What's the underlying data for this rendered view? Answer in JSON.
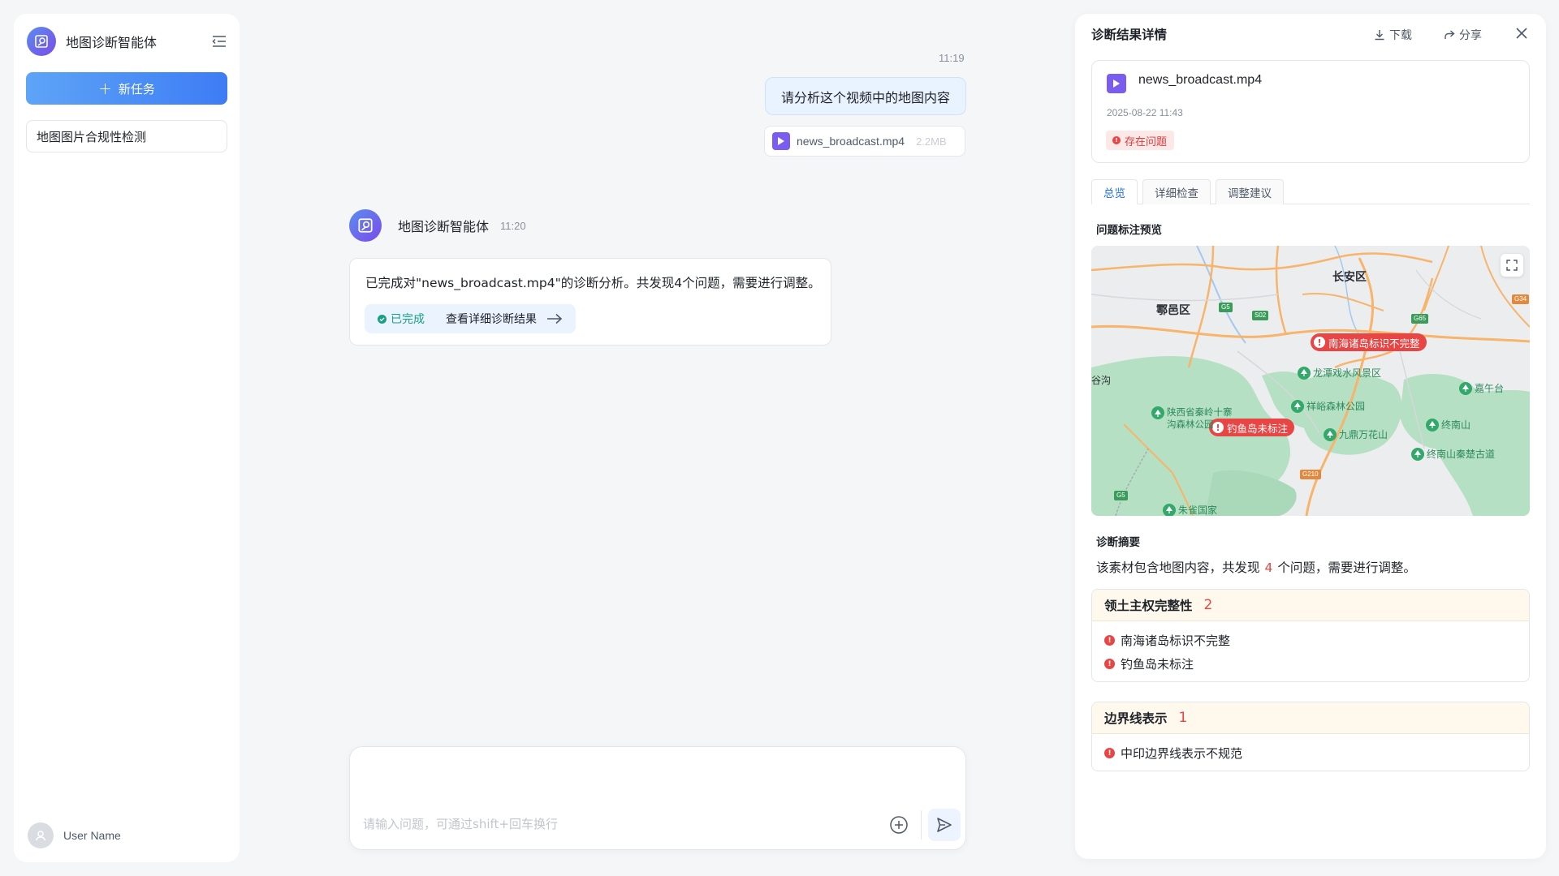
{
  "sidebar": {
    "app_name": "地图诊断智能体",
    "new_task_label": "新任务",
    "history": [
      {
        "label": "地图图片合规性检测"
      }
    ],
    "user_name": "User Name"
  },
  "chat": {
    "user_message": {
      "time": "11:19",
      "text": "请分析这个视频中的地图内容",
      "attachment": {
        "name": "news_broadcast.mp4",
        "size": "2.2MB"
      }
    },
    "bot_message": {
      "name": "地图诊断智能体",
      "time": "11:20",
      "text": "已完成对\"news_broadcast.mp4\"的诊断分析。共发现4个问题，需要进行调整。",
      "status": "已完成",
      "link_label": "查看详细诊断结果"
    },
    "composer": {
      "placeholder": "请输入问题，可通过shift+回车换行"
    }
  },
  "panel": {
    "title": "诊断结果详情",
    "download_label": "下载",
    "share_label": "分享",
    "file": {
      "name": "news_broadcast.mp4",
      "date": "2025-08-22 11:43",
      "status": "存在问题"
    },
    "tabs": [
      {
        "label": "总览",
        "active": true
      },
      {
        "label": "详细检查",
        "active": false
      },
      {
        "label": "调整建议",
        "active": false
      }
    ],
    "preview_label": "问题标注预览",
    "map": {
      "districts": [
        "长安区",
        "鄠邑区",
        "谷沟"
      ],
      "problems": [
        "南海诸岛标识不完整",
        "钓鱼岛未标注"
      ],
      "pois": [
        "龙潭戏水风景区",
        "嘉午台",
        "祥峪森林公园",
        "陕西省秦岭十寨",
        "沟森林公园",
        "九鼎万花山",
        "终南山",
        "终南山秦楚古道",
        "朱雀国家"
      ],
      "shields": [
        "G5",
        "S02",
        "G65",
        "G34",
        "G210",
        "G5"
      ]
    },
    "summary": {
      "label": "诊断摘要",
      "prefix": "该素材包含地图内容，共发现",
      "count": "4",
      "suffix": "个问题，需要进行调整。"
    },
    "groups": [
      {
        "title": "领土主权完整性",
        "count": "2",
        "items": [
          "南海诸岛标识不完整",
          "钓鱼岛未标注"
        ]
      },
      {
        "title": "边界线表示",
        "count": "1",
        "items": [
          "中印边界线表示不规范"
        ]
      }
    ]
  },
  "colors": {
    "accent": "#3d7cf5",
    "error": "#e84545",
    "success": "#16a085",
    "brand_gradient_start": "#5b8def",
    "brand_gradient_end": "#7a4bea"
  }
}
